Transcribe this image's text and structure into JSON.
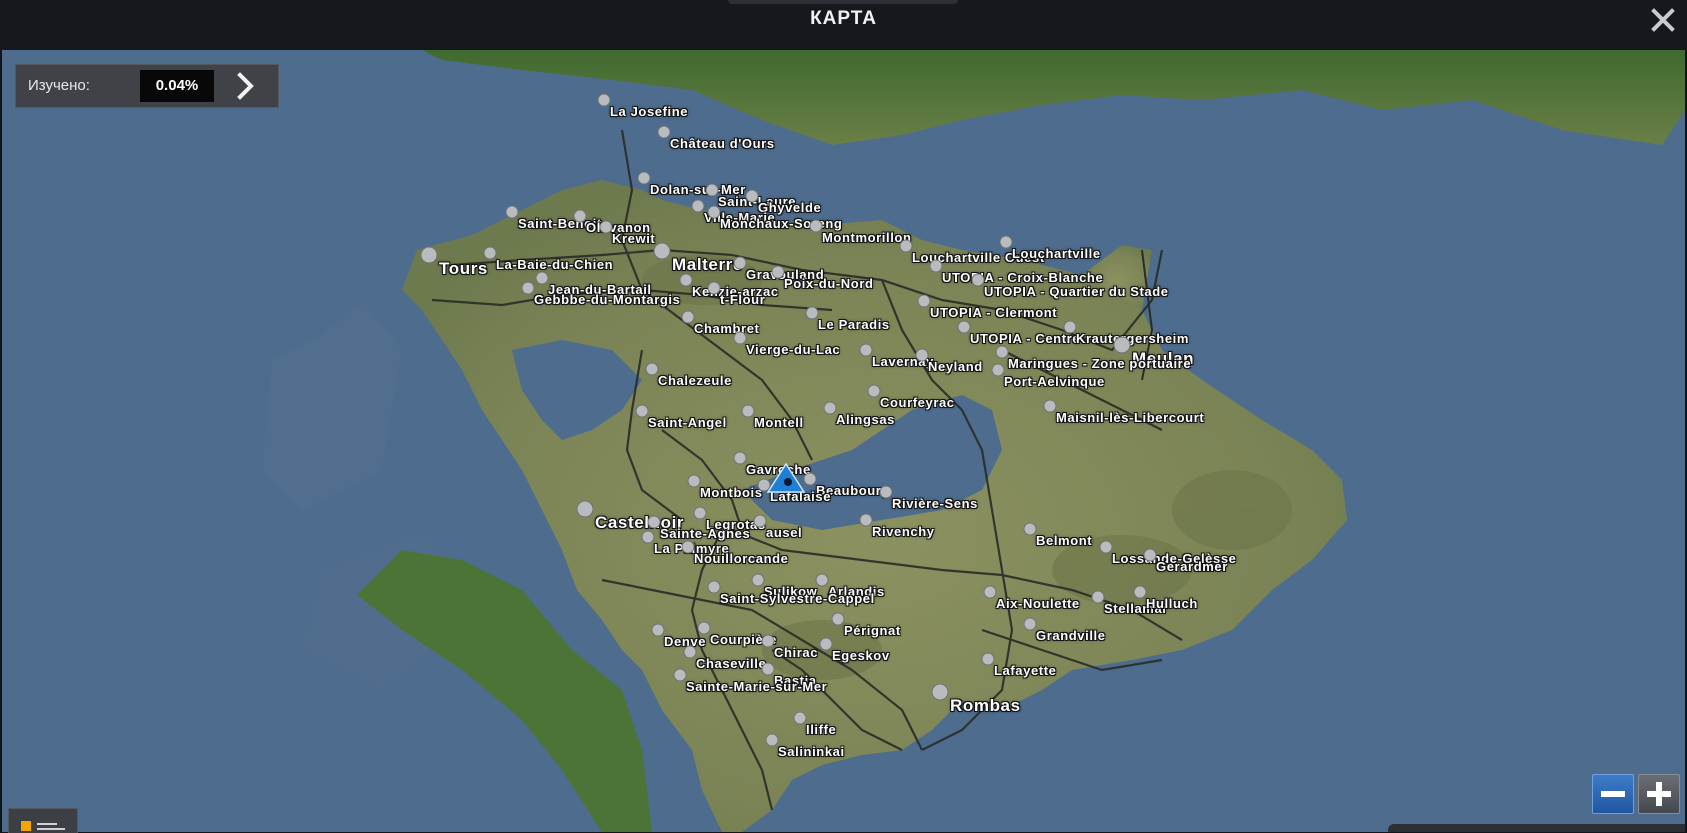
{
  "window": {
    "title": "КАРТА"
  },
  "explored": {
    "label": "Изучено:",
    "value": "0.04%"
  },
  "icons": {
    "close": "close-x-icon",
    "next": "chevron-right-icon",
    "player": "player-truck-marker-icon",
    "city": "city-dot-icon",
    "zoom_out": "minus-icon",
    "zoom_in": "plus-icon",
    "legend": "legend-icon"
  },
  "colors": {
    "sea": "#4d6c8e",
    "land": "#7f8a58",
    "road": "#2a2c28",
    "player_marker": "#1f7fd6",
    "zoom_out_accent": "#2f6bb8"
  },
  "cities": [
    {
      "name": "La Josefine",
      "big": false
    },
    {
      "name": "Château d'Ours",
      "big": false
    },
    {
      "name": "Dolan-sur-Mer",
      "big": false
    },
    {
      "name": "Saint-Laure",
      "big": false
    },
    {
      "name": "Ghyvelde",
      "big": false
    },
    {
      "name": "Ville-Marie",
      "big": false
    },
    {
      "name": "Saint-Benoit",
      "big": false
    },
    {
      "name": "Monchaux-Soreng",
      "big": false
    },
    {
      "name": "Ollivanon",
      "big": false
    },
    {
      "name": "Krewit",
      "big": false
    },
    {
      "name": "Montmorillon",
      "big": false
    },
    {
      "name": "Tours",
      "big": true
    },
    {
      "name": "La-Baie-du-Chien",
      "big": false
    },
    {
      "name": "Malterre",
      "big": true
    },
    {
      "name": "Louchartville Ouest",
      "big": false
    },
    {
      "name": "Louchartville",
      "big": false
    },
    {
      "name": "UTOPIA - Croix-Blanche",
      "big": false
    },
    {
      "name": "Gravouland",
      "big": false
    },
    {
      "name": "Jean-du-Bartail",
      "big": false
    },
    {
      "name": "Kenzie-arzac",
      "big": false
    },
    {
      "name": "Poix-du-Nord",
      "big": false
    },
    {
      "name": "UTOPIA - Quartier du Stade",
      "big": false
    },
    {
      "name": "Gebbbe-du-Montargis",
      "big": false
    },
    {
      "name": "t-Flour",
      "big": false
    },
    {
      "name": "UTOPIA - Clermont",
      "big": false
    },
    {
      "name": "Le Paradis",
      "big": false
    },
    {
      "name": "Chambret",
      "big": false
    },
    {
      "name": "UTOPIA - Centre",
      "big": false
    },
    {
      "name": "Krautergersheim",
      "big": false
    },
    {
      "name": "Vierge-du-Lac",
      "big": false
    },
    {
      "name": "Meulan",
      "big": true
    },
    {
      "name": "Lavernay",
      "big": false
    },
    {
      "name": "Neyland",
      "big": false
    },
    {
      "name": "Maringues - Zone portuaire",
      "big": false
    },
    {
      "name": "Port-Aelvinque",
      "big": false
    },
    {
      "name": "Chalezeule",
      "big": false
    },
    {
      "name": "Courfeyrac",
      "big": false
    },
    {
      "name": "Maisnil-lès-Libercourt",
      "big": false
    },
    {
      "name": "Saint-Angel",
      "big": false
    },
    {
      "name": "Montell",
      "big": false
    },
    {
      "name": "Alingsas",
      "big": false
    },
    {
      "name": "Gavroche",
      "big": false
    },
    {
      "name": "Beaubourg",
      "big": false
    },
    {
      "name": "Montbois",
      "big": false
    },
    {
      "name": "Lafalaise",
      "big": false
    },
    {
      "name": "Rivière-Sens",
      "big": false
    },
    {
      "name": "Castelnoir",
      "big": true
    },
    {
      "name": "Legrotas",
      "big": false
    },
    {
      "name": "Sainte-Agnes",
      "big": false
    },
    {
      "name": "ausel",
      "big": false
    },
    {
      "name": "Rivenchy",
      "big": false
    },
    {
      "name": "Belmont",
      "big": false
    },
    {
      "name": "La Palmyre",
      "big": false
    },
    {
      "name": "Nouillorcande",
      "big": false
    },
    {
      "name": "Lossande-Gelèsse",
      "big": false
    },
    {
      "name": "Gerardmer",
      "big": false
    },
    {
      "name": "Sulikow",
      "big": false
    },
    {
      "name": "Arlandis",
      "big": false
    },
    {
      "name": "Saint-Sylvestre-Cappel",
      "big": false
    },
    {
      "name": "Aix-Noulette",
      "big": false
    },
    {
      "name": "Stellamar",
      "big": false
    },
    {
      "name": "Hulluch",
      "big": false
    },
    {
      "name": "Pérignat",
      "big": false
    },
    {
      "name": "Denve",
      "big": false
    },
    {
      "name": "Courpière",
      "big": false
    },
    {
      "name": "Grandville",
      "big": false
    },
    {
      "name": "Chirac",
      "big": false
    },
    {
      "name": "Egeskov",
      "big": false
    },
    {
      "name": "Chaseville",
      "big": false
    },
    {
      "name": "Lafayette",
      "big": false
    },
    {
      "name": "Bastia",
      "big": false
    },
    {
      "name": "Sainte-Marie-sur-Mer",
      "big": false
    },
    {
      "name": "Rombas",
      "big": true
    },
    {
      "name": "Iliffe",
      "big": false
    },
    {
      "name": "Salininkai",
      "big": false
    }
  ]
}
